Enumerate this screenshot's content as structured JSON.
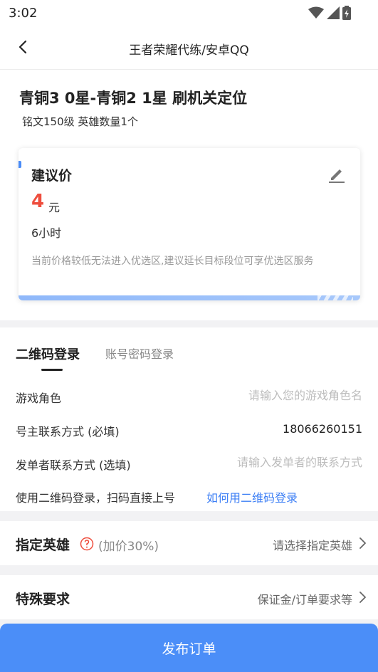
{
  "status_bar": {
    "time": "3:02"
  },
  "nav": {
    "title": "王者荣耀代练/安卓QQ"
  },
  "order": {
    "title": "青铜3 0星-青铜2 1星 刷机关定位",
    "subtitle": "铭文150级 英雄数量1个"
  },
  "price_card": {
    "title": "建议价",
    "price": "4",
    "unit": "元",
    "duration": "6小时",
    "hint": "当前价格较低无法进入优选区,建议延长目标段位可享优选区服务"
  },
  "login": {
    "tab_qr": "二维码登录",
    "tab_password": "账号密码登录",
    "fields": [
      {
        "label": "游戏角色",
        "value": "",
        "placeholder": "请输入您的游戏角色名"
      },
      {
        "label": "号主联系方式 (必填)",
        "value": "18066260151",
        "placeholder": ""
      },
      {
        "label": "发单者联系方式 (选填)",
        "value": "",
        "placeholder": "请输入发单者的联系方式"
      }
    ],
    "qr_note": "使用二维码登录，扫码直接上号",
    "qr_link": "如何用二维码登录"
  },
  "hero_row": {
    "title": "指定英雄",
    "extra": "(加价30%)",
    "value": "请选择指定英雄"
  },
  "special_row": {
    "title": "特殊要求",
    "value": "保证金/订单要求等"
  },
  "submit": {
    "label": "发布订单"
  },
  "colors": {
    "accent": "#4b8ef8",
    "price": "#ee4e3e",
    "link": "#3d7ff5"
  }
}
